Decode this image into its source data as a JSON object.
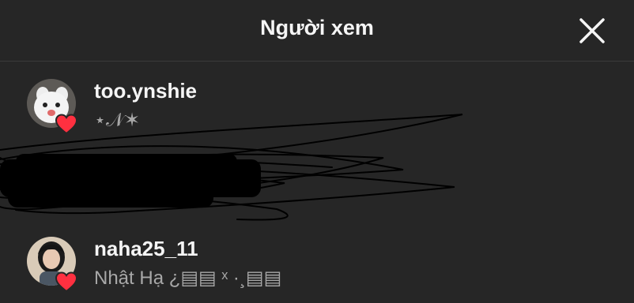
{
  "header": {
    "title": "Người xem",
    "close_icon": "close-icon"
  },
  "viewers": [
    {
      "username": "too.ynshie",
      "subtitle": "⋆𝒩✶",
      "liked": true,
      "avatar": "avatar-white-cat"
    },
    {
      "username": "naha25_11",
      "subtitle": "Nhật Hạ ¿▤▤ ˣ ·¸▤▤",
      "liked": true,
      "avatar": "avatar-person-photo"
    }
  ],
  "colors": {
    "background": "#262626",
    "text_primary": "#f5f5f5",
    "text_secondary": "#a8a8a8",
    "heart": "#ff3040",
    "divider": "#3a3a3a"
  }
}
